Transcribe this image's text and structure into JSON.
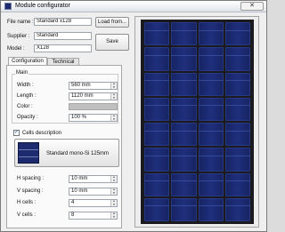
{
  "window": {
    "title": "Module configurator",
    "close_glyph": "✕"
  },
  "fields": {
    "file_name": {
      "label": "File name :",
      "value": "Standard x128"
    },
    "supplier": {
      "label": "Supplier :",
      "value": "Standard"
    },
    "model": {
      "label": "Model :",
      "value": "X128"
    }
  },
  "buttons": {
    "load": "Load from...",
    "save": "Save"
  },
  "tabs": [
    {
      "label": "Configuration",
      "active": true
    },
    {
      "label": "Technical",
      "active": false
    }
  ],
  "main": {
    "title": "Main",
    "width": {
      "label": "Width :",
      "value": "560 mm"
    },
    "length": {
      "label": "Length :",
      "value": "1120 mm"
    },
    "color": {
      "label": "Color :",
      "value": "#bfbfbf"
    },
    "opacity": {
      "label": "Opacity :",
      "value": "100 %"
    }
  },
  "cells": {
    "checkbox_label": "Cells description",
    "checked": true,
    "button_label": "Standard mono-Si 125mm",
    "h_spacing": {
      "label": "H spacing :",
      "value": "10 mm"
    },
    "v_spacing": {
      "label": "V spacing :",
      "value": "10 mm"
    },
    "h_cells": {
      "label": "H cells :",
      "value": "4"
    },
    "v_cells": {
      "label": "V cells :",
      "value": "8"
    }
  },
  "preview": {
    "columns": 4,
    "rows": 8,
    "cell_color": "#1f2f7c"
  },
  "icons": {
    "spin_up": "▲",
    "spin_down": "▼",
    "check": "✓"
  }
}
